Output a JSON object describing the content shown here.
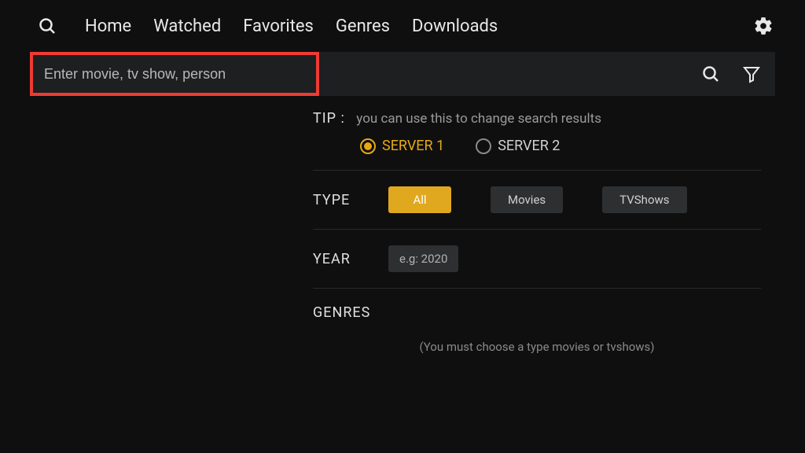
{
  "nav": {
    "items": [
      "Home",
      "Watched",
      "Favorites",
      "Genres",
      "Downloads"
    ]
  },
  "search": {
    "placeholder": "Enter movie, tv show, person"
  },
  "tip": {
    "label": "TIP :",
    "text": "you can use this to change search results"
  },
  "servers": {
    "option1": "SERVER 1",
    "option2": "SERVER 2",
    "selected": 0
  },
  "type": {
    "label": "TYPE",
    "options": [
      "All",
      "Movies",
      "TVShows"
    ],
    "selected": 0
  },
  "year": {
    "label": "YEAR",
    "placeholder": "e.g: 2020"
  },
  "genres": {
    "label": "GENRES",
    "note": "(You must choose a type movies or tvshows)"
  },
  "colors": {
    "accent": "#e6a817",
    "highlight": "#ef3b33"
  }
}
